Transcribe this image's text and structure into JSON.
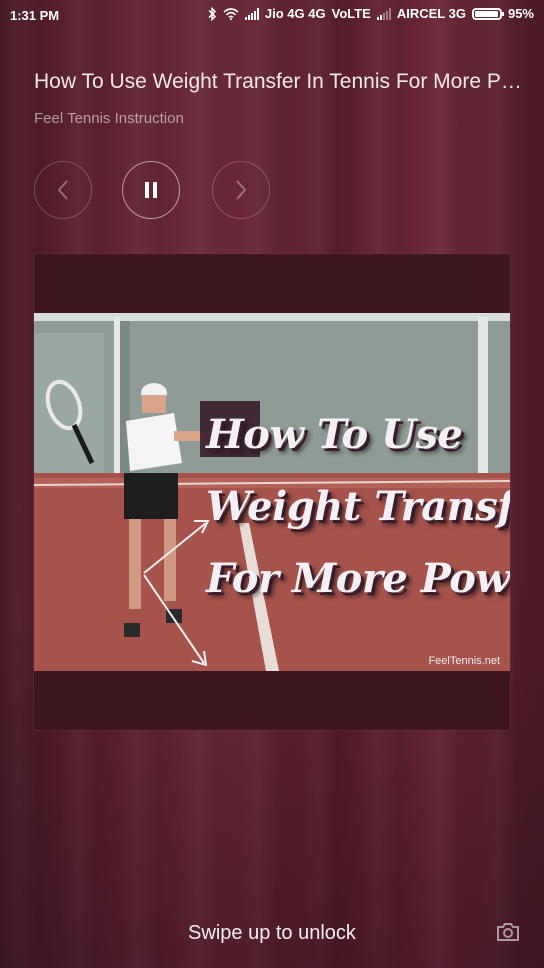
{
  "status_bar": {
    "time": "1:31 PM",
    "carrier1": "Jio 4G 4G",
    "network_type": "VoLTE",
    "carrier2": "AIRCEL 3G",
    "battery_percent": "95%",
    "battery_level": 0.95
  },
  "player": {
    "title": "How To Use Weight Transfer In Tennis For More Power",
    "artist": "Feel Tennis Instruction",
    "controls": {
      "prev": "previous-icon",
      "play_pause": "pause-icon",
      "next": "next-icon"
    }
  },
  "album_art": {
    "line1": "How To Use",
    "line2": "Weight Transfer",
    "line3": "For More Power",
    "watermark": "FeelTennis.net"
  },
  "lockscreen": {
    "unlock_hint": "Swipe up to unlock",
    "camera": "camera-icon"
  }
}
